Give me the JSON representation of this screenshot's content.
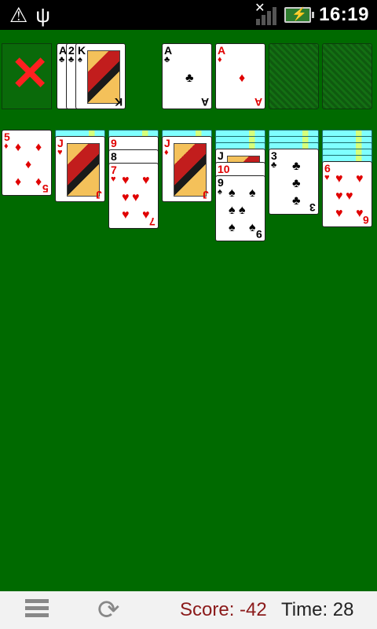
{
  "status_bar": {
    "left_icons": [
      "warning-icon",
      "usb-icon"
    ],
    "time": "16:19",
    "signal_bars": 4,
    "battery": "charging"
  },
  "colors": {
    "felt": "#006a00",
    "red_suit": "#e00000",
    "score": "#8b1a1a"
  },
  "top_row": {
    "redeal_symbol": "✕",
    "waste": [
      {
        "rank": "A",
        "suit": "♣"
      },
      {
        "rank": "2",
        "suit": "♣"
      },
      {
        "rank": "K",
        "suit": "♠"
      }
    ],
    "foundations": [
      {
        "rank": "A",
        "suit": "♣"
      },
      {
        "rank": "A",
        "suit": "♦"
      },
      {
        "empty": true
      },
      {
        "empty": true
      }
    ]
  },
  "tableau": [
    {
      "face_down": 0,
      "cards": [
        {
          "rank": "5",
          "suit": "♦"
        }
      ]
    },
    {
      "face_down": 1,
      "cards": [
        {
          "rank": "J",
          "suit": "♥"
        }
      ]
    },
    {
      "face_down": 1,
      "cards": [
        {
          "rank": "9",
          "suit": "♥"
        },
        {
          "rank": "8",
          "suit": "♠"
        },
        {
          "rank": "7",
          "suit": "♥"
        }
      ]
    },
    {
      "face_down": 1,
      "cards": [
        {
          "rank": "J",
          "suit": "♦"
        }
      ]
    },
    {
      "face_down": 3,
      "cards": [
        {
          "rank": "J",
          "suit": "♠"
        },
        {
          "rank": "10",
          "suit": "♥"
        },
        {
          "rank": "9",
          "suit": "♠"
        }
      ]
    },
    {
      "face_down": 3,
      "cards": [
        {
          "rank": "3",
          "suit": "♣"
        }
      ]
    },
    {
      "face_down": 5,
      "cards": [
        {
          "rank": "6",
          "suit": "♥"
        }
      ]
    }
  ],
  "bottom_bar": {
    "score_text": "Score: -42",
    "time_text": "Time: 28"
  }
}
